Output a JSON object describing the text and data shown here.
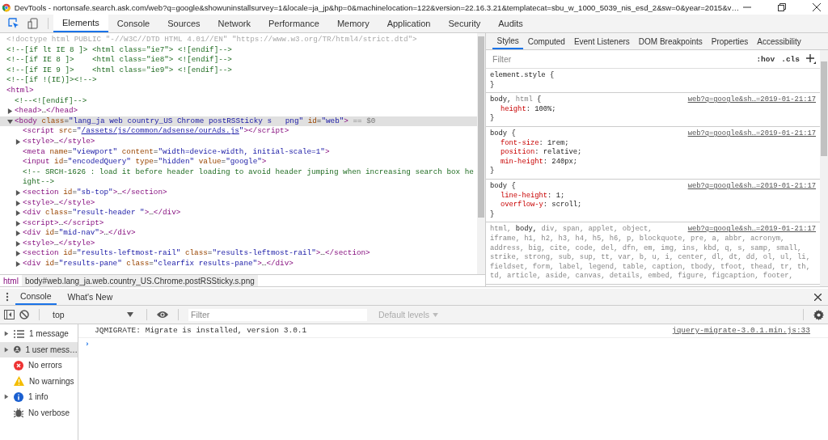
{
  "window": {
    "title": "DevTools - nortonsafe.search.ask.com/web?q=google&showuninstallsurvey=1&locale=ja_jp&hp=0&machinelocation=122&version=22.16.3.21&templatecat=sbu_w_1000_5039_nis_esd_2&sw=0&year=2015&v…"
  },
  "tabs": [
    {
      "label": "Elements",
      "selected": true
    },
    {
      "label": "Console",
      "selected": false
    },
    {
      "label": "Sources",
      "selected": false
    },
    {
      "label": "Network",
      "selected": false
    },
    {
      "label": "Performance",
      "selected": false
    },
    {
      "label": "Memory",
      "selected": false
    },
    {
      "label": "Application",
      "selected": false
    },
    {
      "label": "Security",
      "selected": false
    },
    {
      "label": "Audits",
      "selected": false
    }
  ],
  "dom_tree": [
    {
      "selected": false,
      "parts": [
        {
          "kind": "doctype",
          "text": "<!doctype html PUBLIC \"-//W3C//DTD HTML 4.01//EN\" \"https://www.w3.org/TR/html4/strict.dtd\">"
        }
      ]
    },
    {
      "selected": false,
      "parts": [
        {
          "kind": "comment",
          "text": "<!--[if lt IE 8 ]> <html class=\"ie7\"> <![endif]-->"
        }
      ]
    },
    {
      "selected": false,
      "parts": [
        {
          "kind": "comment",
          "text": "<!--[if IE 8 ]>    <html class=\"ie8\"> <![endif]-->"
        }
      ]
    },
    {
      "selected": false,
      "parts": [
        {
          "kind": "comment",
          "text": "<!--[if IE 9 ]>    <html class=\"ie9\"> <![endif]-->"
        }
      ]
    },
    {
      "selected": false,
      "parts": [
        {
          "kind": "comment",
          "text": "<!--[if !(IE)]><!-->"
        }
      ]
    },
    {
      "selected": false,
      "parts": [
        {
          "kind": "tag",
          "text": "<html>"
        }
      ],
      "children": [
        {
          "selected": false,
          "parts": [
            {
              "kind": "comment",
              "text": "<!--<![endif]-->"
            }
          ]
        },
        {
          "selected": false,
          "expanded": false,
          "parts": [
            {
              "kind": "tag",
              "text": "<head>"
            },
            {
              "kind": "text",
              "text": "…"
            },
            {
              "kind": "tag",
              "text": "</head>"
            }
          ]
        },
        {
          "selected": true,
          "expanded": true,
          "parts": [
            {
              "kind": "tag",
              "text": "<body "
            },
            {
              "kind": "attr",
              "text": "class"
            },
            {
              "kind": "text",
              "text": "="
            },
            {
              "kind": "val",
              "text": "\"lang_ja web country_US Chrome postRSSticky s   png\""
            },
            {
              "kind": "attr",
              "text": " id"
            },
            {
              "kind": "text",
              "text": "="
            },
            {
              "kind": "val",
              "text": "\"web\""
            },
            {
              "kind": "tag",
              "text": ">"
            },
            {
              "kind": "marker",
              "text": " == $0"
            }
          ],
          "children": [
            {
              "selected": false,
              "parts": [
                {
                  "kind": "tag",
                  "text": "<script "
                },
                {
                  "kind": "attr",
                  "text": "src"
                },
                {
                  "kind": "text",
                  "text": "="
                },
                {
                  "kind": "val",
                  "text": "\""
                },
                {
                  "kind": "link",
                  "text": "/assets/js/common/adsense/ourAds.js"
                },
                {
                  "kind": "val",
                  "text": "\""
                },
                {
                  "kind": "tag",
                  "text": "></script>"
                }
              ]
            },
            {
              "selected": false,
              "expanded": false,
              "parts": [
                {
                  "kind": "tag",
                  "text": "<style>"
                },
                {
                  "kind": "text",
                  "text": "…"
                },
                {
                  "kind": "tag",
                  "text": "</style>"
                }
              ]
            },
            {
              "selected": false,
              "parts": [
                {
                  "kind": "tag",
                  "text": "<meta "
                },
                {
                  "kind": "attr",
                  "text": "name"
                },
                {
                  "kind": "text",
                  "text": "="
                },
                {
                  "kind": "val",
                  "text": "\"viewport\""
                },
                {
                  "kind": "attr",
                  "text": " content"
                },
                {
                  "kind": "text",
                  "text": "="
                },
                {
                  "kind": "val",
                  "text": "\"width=device-width, initial-scale=1\""
                },
                {
                  "kind": "tag",
                  "text": ">"
                }
              ]
            },
            {
              "selected": false,
              "parts": [
                {
                  "kind": "tag",
                  "text": "<input "
                },
                {
                  "kind": "attr",
                  "text": "id"
                },
                {
                  "kind": "text",
                  "text": "="
                },
                {
                  "kind": "val",
                  "text": "\"encodedQuery\""
                },
                {
                  "kind": "attr",
                  "text": " type"
                },
                {
                  "kind": "text",
                  "text": "="
                },
                {
                  "kind": "val",
                  "text": "\"hidden\""
                },
                {
                  "kind": "attr",
                  "text": " value"
                },
                {
                  "kind": "text",
                  "text": "="
                },
                {
                  "kind": "val",
                  "text": "\"google\""
                },
                {
                  "kind": "tag",
                  "text": ">"
                }
              ]
            },
            {
              "selected": false,
              "parts": [
                {
                  "kind": "comment",
                  "text": "<!-- SRCH-1626 : load it before header loading to avoid header jumping when increasing search box height-->"
                }
              ]
            },
            {
              "selected": false,
              "expanded": false,
              "parts": [
                {
                  "kind": "tag",
                  "text": "<section "
                },
                {
                  "kind": "attr",
                  "text": "id"
                },
                {
                  "kind": "text",
                  "text": "="
                },
                {
                  "kind": "val",
                  "text": "\"sb-top\""
                },
                {
                  "kind": "tag",
                  "text": ">"
                },
                {
                  "kind": "text",
                  "text": "…"
                },
                {
                  "kind": "tag",
                  "text": "</section>"
                }
              ]
            },
            {
              "selected": false,
              "expanded": false,
              "parts": [
                {
                  "kind": "tag",
                  "text": "<style>"
                },
                {
                  "kind": "text",
                  "text": "…"
                },
                {
                  "kind": "tag",
                  "text": "</style>"
                }
              ]
            },
            {
              "selected": false,
              "expanded": false,
              "parts": [
                {
                  "kind": "tag",
                  "text": "<div "
                },
                {
                  "kind": "attr",
                  "text": "class"
                },
                {
                  "kind": "text",
                  "text": "="
                },
                {
                  "kind": "val",
                  "text": "\"result-header \""
                },
                {
                  "kind": "tag",
                  "text": ">"
                },
                {
                  "kind": "text",
                  "text": "…"
                },
                {
                  "kind": "tag",
                  "text": "</div>"
                }
              ]
            },
            {
              "selected": false,
              "expanded": false,
              "parts": [
                {
                  "kind": "tag",
                  "text": "<script>"
                },
                {
                  "kind": "text",
                  "text": "…"
                },
                {
                  "kind": "tag",
                  "text": "</script>"
                }
              ]
            },
            {
              "selected": false,
              "expanded": false,
              "parts": [
                {
                  "kind": "tag",
                  "text": "<div "
                },
                {
                  "kind": "attr",
                  "text": "id"
                },
                {
                  "kind": "text",
                  "text": "="
                },
                {
                  "kind": "val",
                  "text": "\"mid-nav\""
                },
                {
                  "kind": "tag",
                  "text": ">"
                },
                {
                  "kind": "text",
                  "text": "…"
                },
                {
                  "kind": "tag",
                  "text": "</div>"
                }
              ]
            },
            {
              "selected": false,
              "expanded": false,
              "parts": [
                {
                  "kind": "tag",
                  "text": "<style>"
                },
                {
                  "kind": "text",
                  "text": "…"
                },
                {
                  "kind": "tag",
                  "text": "</style>"
                }
              ]
            },
            {
              "selected": false,
              "expanded": false,
              "parts": [
                {
                  "kind": "tag",
                  "text": "<section "
                },
                {
                  "kind": "attr",
                  "text": "id"
                },
                {
                  "kind": "text",
                  "text": "="
                },
                {
                  "kind": "val",
                  "text": "\"results-leftmost-rail\""
                },
                {
                  "kind": "attr",
                  "text": " class"
                },
                {
                  "kind": "text",
                  "text": "="
                },
                {
                  "kind": "val",
                  "text": "\"results-leftmost-rail\""
                },
                {
                  "kind": "tag",
                  "text": ">"
                },
                {
                  "kind": "text",
                  "text": "…"
                },
                {
                  "kind": "tag",
                  "text": "</section>"
                }
              ]
            },
            {
              "selected": false,
              "expanded": false,
              "parts": [
                {
                  "kind": "tag",
                  "text": "<div "
                },
                {
                  "kind": "attr",
                  "text": "id"
                },
                {
                  "kind": "text",
                  "text": "="
                },
                {
                  "kind": "val",
                  "text": "\"results-pane\""
                },
                {
                  "kind": "attr",
                  "text": " class"
                },
                {
                  "kind": "text",
                  "text": "="
                },
                {
                  "kind": "val",
                  "text": "\"clearfix results-pane\""
                },
                {
                  "kind": "tag",
                  "text": ">"
                },
                {
                  "kind": "text",
                  "text": "…"
                },
                {
                  "kind": "tag",
                  "text": "</div>"
                }
              ]
            }
          ]
        }
      ]
    }
  ],
  "breadcrumbs": [
    {
      "label": "html",
      "selected": false
    },
    {
      "label": "body#web.lang_ja.web.country_US.Chrome.postRSSticky.s.png",
      "selected": true
    }
  ],
  "styles_tabs": [
    {
      "label": "Styles",
      "selected": true
    },
    {
      "label": "Computed",
      "selected": false
    },
    {
      "label": "Event Listeners",
      "selected": false
    },
    {
      "label": "DOM Breakpoints",
      "selected": false
    },
    {
      "label": "Properties",
      "selected": false
    },
    {
      "label": "Accessibility",
      "selected": false
    }
  ],
  "styles_filter": {
    "placeholder": "Filter",
    "hov": ":hov",
    "cls": ".cls"
  },
  "rules": [
    {
      "selector": [
        {
          "text": "element.style {",
          "matched": true
        }
      ],
      "close": "}"
    },
    {
      "selector": [
        {
          "text": "body, ",
          "matched": true
        },
        {
          "text": "html",
          "matched": false
        },
        {
          "text": " {",
          "matched": true
        }
      ],
      "source": "web?q=google&sh…=2019-01-21:17",
      "declarations": [
        {
          "property": "height",
          "value": ": 100%;"
        }
      ],
      "close": "}"
    },
    {
      "selector": [
        {
          "text": "body {",
          "matched": true
        }
      ],
      "source": "web?q=google&sh…=2019-01-21:17",
      "declarations": [
        {
          "property": "font-size",
          "value": ": 1rem;"
        },
        {
          "property": "position",
          "value": ": relative;"
        },
        {
          "property": "min-height",
          "value": ": 240px;"
        }
      ],
      "close": "}"
    },
    {
      "selector": [
        {
          "text": "body {",
          "matched": true
        }
      ],
      "source": "web?q=google&sh…=2019-01-21:17",
      "declarations": [
        {
          "property": "line-height",
          "value": ": 1;"
        },
        {
          "property": "overflow-y",
          "value": ": scroll;"
        }
      ],
      "close": "}"
    },
    {
      "selector": [
        {
          "text": "html, ",
          "matched": false
        },
        {
          "text": "body, ",
          "matched": true
        },
        {
          "text": "div, span, applet, object,",
          "matched": false
        }
      ],
      "selector_rest": [
        {
          "text": "iframe, h1, h2, h3, h4, h5, h6, p, blockquote, pre, a, abbr, acronym, address, big, cite, code, del, dfn, em, img, ins, kbd, q, s, samp, small, strike, strong, sub, sup, tt, var, b, u, i, center, dl, dt, dd, ol, ul, li, fieldset, form, label, legend, table, caption, tbody, tfoot, thead, tr, th, td, article, aside, canvas, details, embed, figure, figcaption, footer,",
          "matched": false
        }
      ],
      "source": "web?q=google&sh…=2019-01-21:17"
    }
  ],
  "drawer_tabs": [
    {
      "label": "Console",
      "selected": true
    },
    {
      "label": "What's New",
      "selected": false
    }
  ],
  "console_toolbar": {
    "context": "top",
    "filter_placeholder": "Filter",
    "levels": "Default levels"
  },
  "console_sidebar": [
    {
      "kind": "messages",
      "label": "1 message",
      "expanded": false,
      "selected": false
    },
    {
      "kind": "user",
      "label": "1 user mess…",
      "expanded": false,
      "selected": true
    },
    {
      "kind": "error",
      "label": "No errors",
      "selected": false
    },
    {
      "kind": "warning",
      "label": "No warnings",
      "selected": false
    },
    {
      "kind": "info",
      "label": "1 info",
      "expanded": false,
      "selected": false
    },
    {
      "kind": "verbose",
      "label": "No verbose",
      "selected": false
    }
  ],
  "console_messages": [
    {
      "text": "JQMIGRATE: Migrate is installed, version 3.0.1",
      "source": "jquery-migrate-3.0.1.min.js:33"
    }
  ],
  "console_prompt": "›"
}
